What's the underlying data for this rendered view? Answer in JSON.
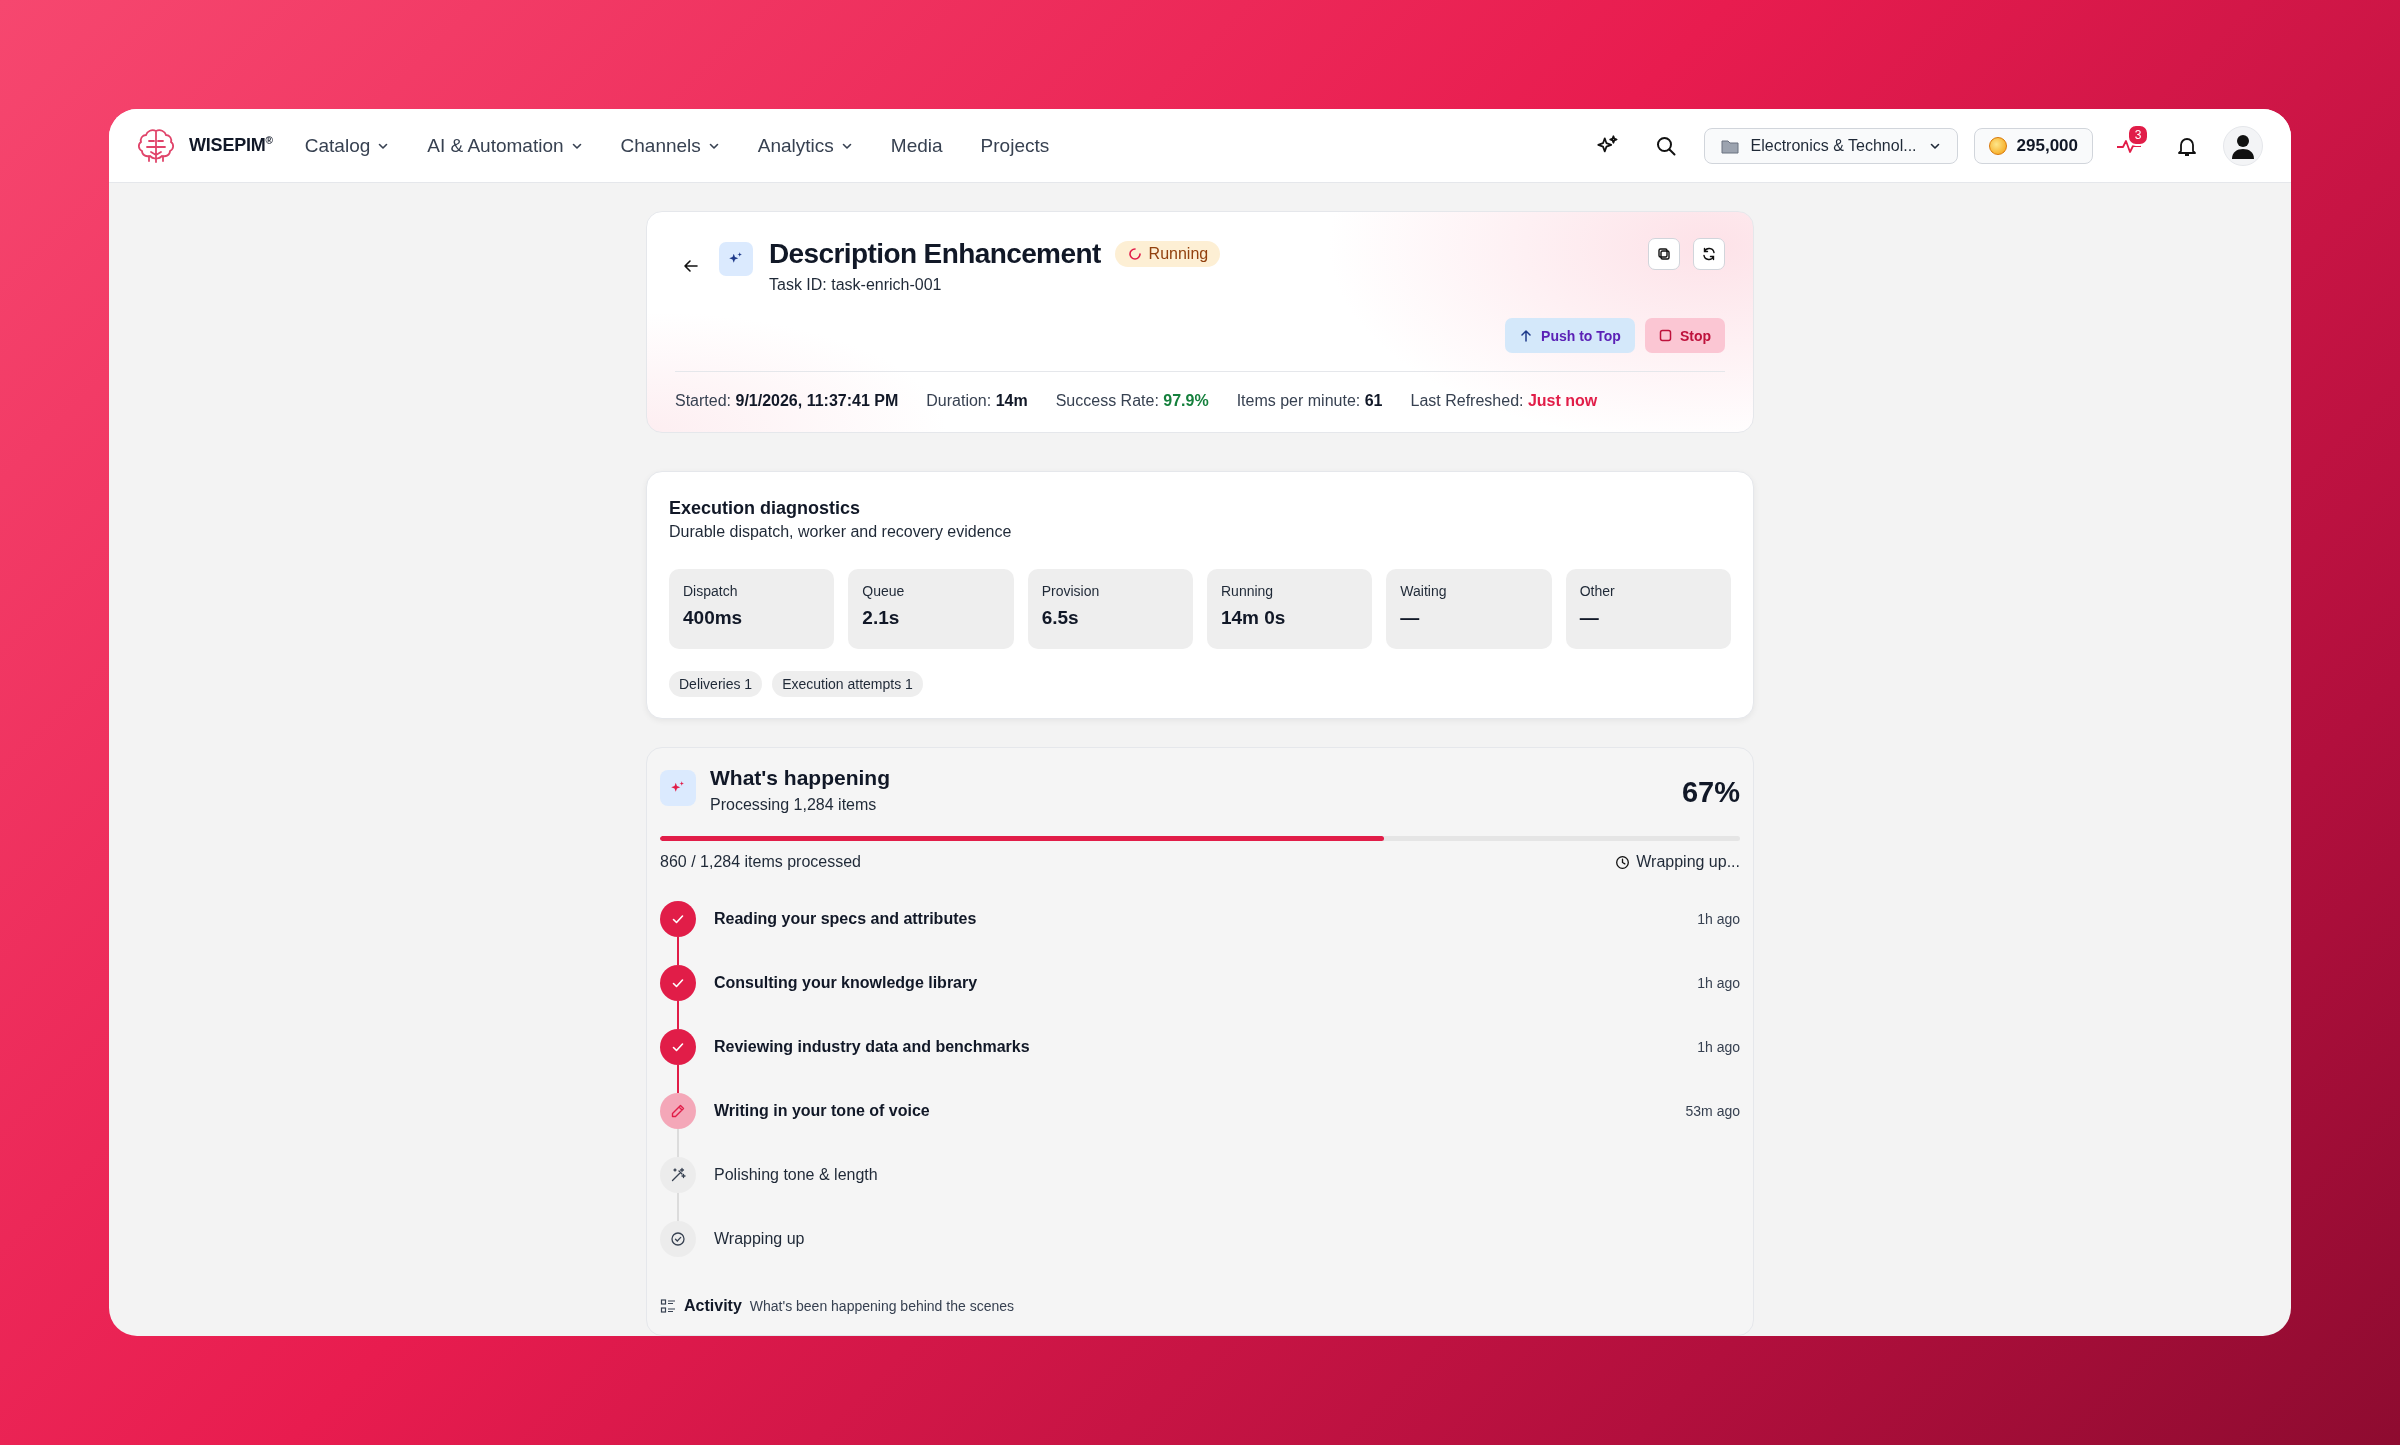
{
  "brand": {
    "name": "WISEPIM",
    "mark": "®"
  },
  "nav": [
    {
      "label": "Catalog",
      "dropdown": true
    },
    {
      "label": "AI & Automation",
      "dropdown": true
    },
    {
      "label": "Channels",
      "dropdown": true
    },
    {
      "label": "Analytics",
      "dropdown": true
    },
    {
      "label": "Media",
      "dropdown": false
    },
    {
      "label": "Projects",
      "dropdown": false
    }
  ],
  "workspace": {
    "label": "Electronics & Technol..."
  },
  "credits": "295,000",
  "activity_badge": "3",
  "task": {
    "title": "Description Enhancement",
    "status": "Running",
    "task_id": "Task ID: task-enrich-001",
    "actions": [
      {
        "label": "Push to Top",
        "kind": "push"
      },
      {
        "label": "Stop",
        "kind": "stop"
      }
    ],
    "meta": [
      {
        "label": "Started:",
        "value": "9/1/2026, 11:37:41 PM",
        "color": "#111827"
      },
      {
        "label": "Duration:",
        "value": "14m",
        "color": "#111827"
      },
      {
        "label": "Success Rate:",
        "value": "97.9%",
        "color": "#15803d"
      },
      {
        "label": "Items per minute:",
        "value": "61",
        "color": "#111827"
      },
      {
        "label": "Last Refreshed:",
        "value": "Just now",
        "color": "#e11d48"
      }
    ]
  },
  "diagnostics": {
    "title": "Execution diagnostics",
    "subtitle": "Durable dispatch, worker and recovery evidence",
    "stats": [
      {
        "label": "Dispatch",
        "value": "400ms"
      },
      {
        "label": "Queue",
        "value": "2.1s"
      },
      {
        "label": "Provision",
        "value": "6.5s"
      },
      {
        "label": "Running",
        "value": "14m 0s"
      },
      {
        "label": "Waiting",
        "value": "—"
      },
      {
        "label": "Other",
        "value": "—"
      }
    ],
    "chips": [
      "Deliveries 1",
      "Execution attempts 1"
    ]
  },
  "progress": {
    "title": "What's happening",
    "subtitle": "Processing 1,284 items",
    "percent": "67%",
    "level": 0.67,
    "count": "860 / 1,284 items processed",
    "phase": "Wrapping up...",
    "steps": [
      {
        "label": "Reading your specs and attributes",
        "time": "1h ago",
        "kind": "done"
      },
      {
        "label": "Consulting your knowledge library",
        "time": "1h ago",
        "kind": "done"
      },
      {
        "label": "Reviewing industry data and benchmarks",
        "time": "1h ago",
        "kind": "done"
      },
      {
        "label": "Writing in your tone of voice",
        "time": "53m ago",
        "kind": "active"
      },
      {
        "label": "Polishing tone & length",
        "kind": "pending"
      },
      {
        "label": "Wrapping up",
        "kind": "pending"
      }
    ],
    "activity": {
      "title": "Activity",
      "subtitle": "What's been happening behind the scenes"
    }
  }
}
